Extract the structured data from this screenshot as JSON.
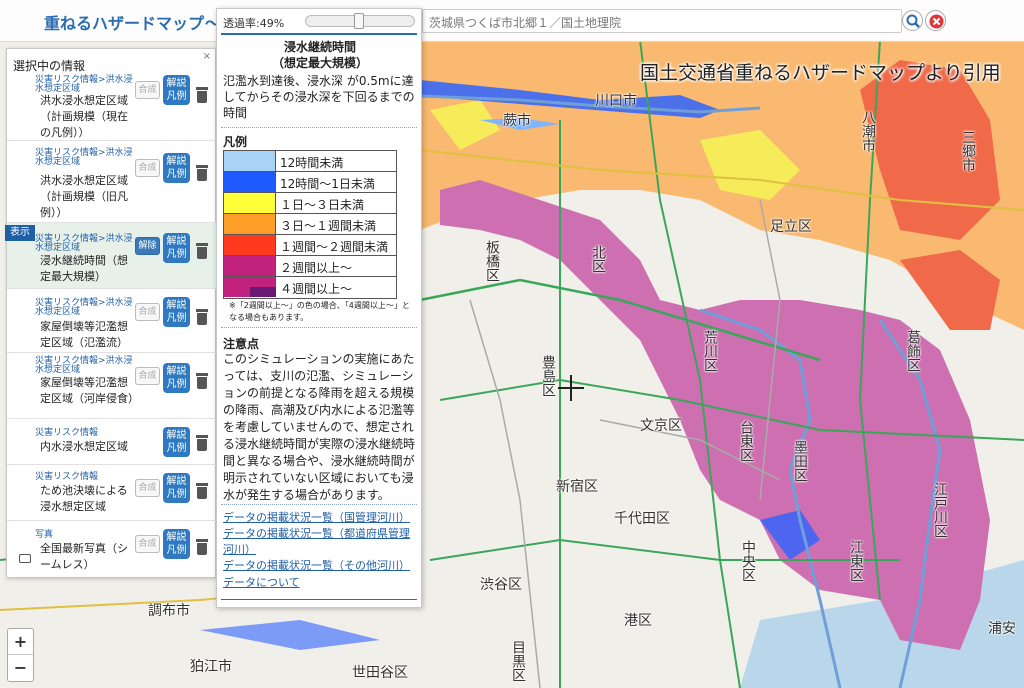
{
  "header": {
    "app_title": "重ねるハザードマップ",
    "title_suffix": "～",
    "search_value": "茨城県つくば市北郷１／国土地理院"
  },
  "map": {
    "attribution": "国土交通省重ねるハザードマップより引用",
    "labels": [
      "川口市",
      "蕨市",
      "足立区",
      "北区",
      "荒川区",
      "葛飾区",
      "豊島区",
      "文京区",
      "台東区",
      "墨田区",
      "新宿区",
      "千代田区",
      "中央区",
      "江東区",
      "江戸川区",
      "渋谷区",
      "港区",
      "世田谷区",
      "目黒区",
      "調布市",
      "狛江市",
      "八潮市",
      "三郷市",
      "板橋区",
      "浦安"
    ]
  },
  "left_panel": {
    "title": "選択中の情報",
    "close_label": "×",
    "display_badge": "表示",
    "layers": [
      {
        "category": "災害リスク情報>洪水浸水想定区域",
        "name": "洪水浸水想定区域（計画規模（現在の凡例））",
        "toggle": "合成",
        "kaisetsu": "解説",
        "hanrei": "凡例"
      },
      {
        "category": "災害リスク情報>洪水浸水想定区域",
        "name": "洪水浸水想定区域（計画規模（旧凡例））",
        "toggle": "合成",
        "kaisetsu": "解説",
        "hanrei": "凡例"
      },
      {
        "category": "災害リスク情報>洪水浸水想定区域",
        "name": "浸水継続時間（想定最大規模）",
        "toggle": "解除",
        "kaisetsu": "解説",
        "hanrei": "凡例"
      },
      {
        "category": "災害リスク情報>洪水浸水想定区域",
        "name": "家屋倒壊等氾濫想定区域（氾濫流）",
        "toggle": "合成",
        "kaisetsu": "解説",
        "hanrei": "凡例"
      },
      {
        "category": "災害リスク情報>洪水浸水想定区域",
        "name": "家屋倒壊等氾濫想定区域（河岸侵食）",
        "toggle": "合成",
        "kaisetsu": "解説",
        "hanrei": "凡例"
      },
      {
        "category": "災害リスク情報",
        "name": "内水浸水想定区域",
        "toggle": "",
        "kaisetsu": "解説",
        "hanrei": "凡例"
      },
      {
        "category": "災害リスク情報",
        "name": "ため池決壊による浸水想定区域",
        "toggle": "合成",
        "kaisetsu": "解説",
        "hanrei": "凡例"
      },
      {
        "category": "写真",
        "name": "全国最新写真（シームレス）",
        "toggle": "合成",
        "kaisetsu": "解説",
        "hanrei": "凡例"
      }
    ]
  },
  "legend": {
    "opacity_label": "透過率:49%",
    "opacity_value": 0.49,
    "title_line1": "浸水継続時間",
    "title_line2": "（想定最大規模）",
    "description": "氾濫水到達後、浸水深 が0.5mに達してからその浸水深を下回るまでの時間",
    "heading": "凡例",
    "items": [
      {
        "color": "#a9d3f5",
        "label": "12時間未満"
      },
      {
        "color": "#1e5aff",
        "label": "12時間～1日未満"
      },
      {
        "color": "#ffff3a",
        "label": "１日～３日未満"
      },
      {
        "color": "#ff9f2a",
        "label": "３日～１週間未満"
      },
      {
        "color": "#ff3a1e",
        "label": "１週間～２週間未満"
      },
      {
        "color": "#c0227d",
        "label": "２週間以上～"
      },
      {
        "color": "#c0227d",
        "inner_color": "#6a1a72",
        "label": "４週間以上～"
      }
    ],
    "note": "※「2週間以上～」の色の場合、「4週間以上～」となる場合もあります。",
    "notes_heading": "注意点",
    "notes_text": "このシミュレーションの実施にあたっては、支川の氾濫、シミュレーションの前提となる降雨を超える規模の降雨、高潮及び内水による氾濫等を考慮していませんので、想定される浸水継続時間が実際の浸水継続時間と異なる場合や、浸水継続時間が明示されていない区域においても浸水が発生する場合があります。",
    "links": [
      "データの掲載状況一覧（国管理河川）",
      "データの掲載状況一覧（都道府県管理河川）",
      "データの掲載状況一覧（その他河川）",
      "データについて"
    ]
  },
  "zoom": {
    "in_label": "+",
    "out_label": "−"
  }
}
